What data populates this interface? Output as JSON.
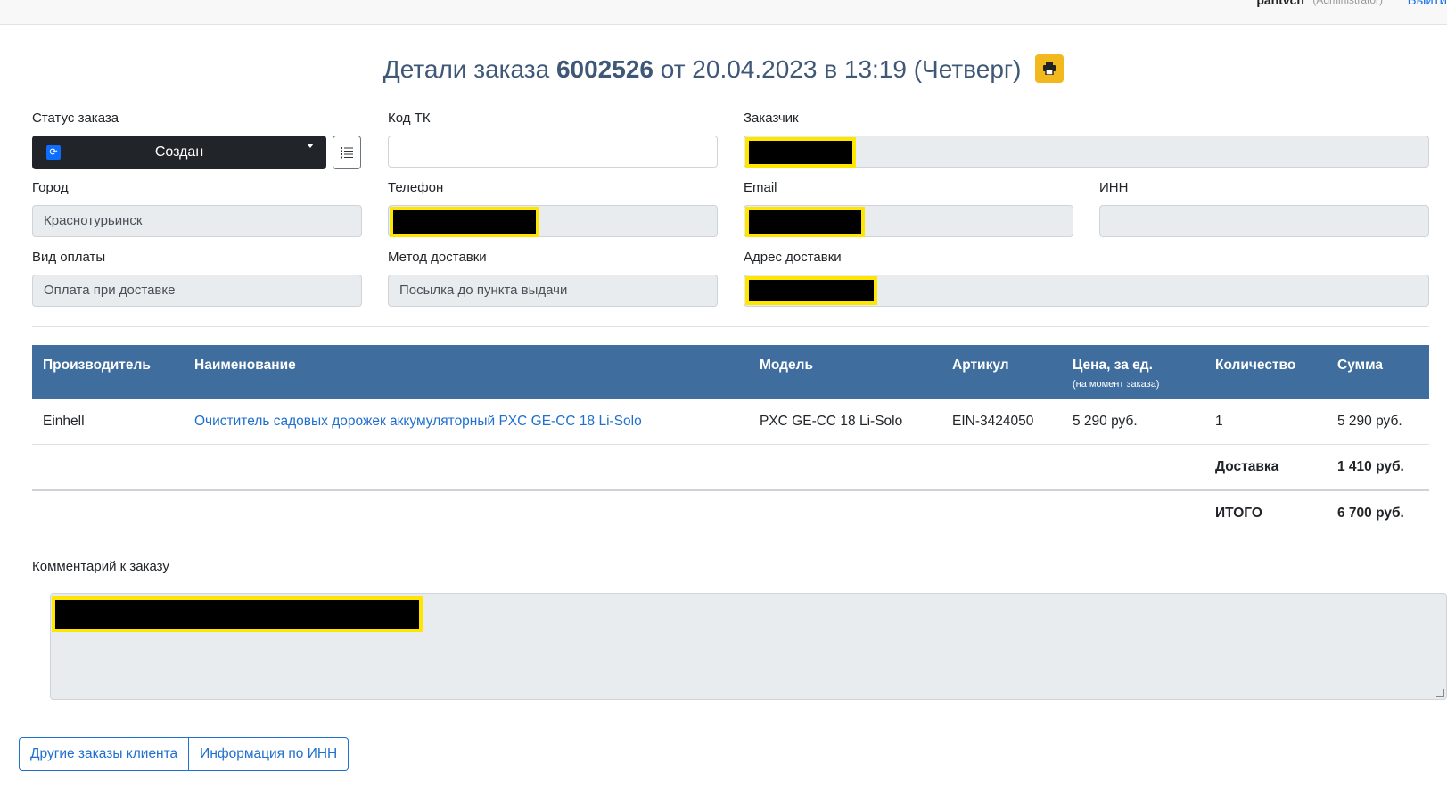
{
  "topbar": {
    "user": "pahtvch",
    "role": "(Administrator)",
    "logout": "Выйти"
  },
  "header": {
    "title_prefix": "Детали заказа",
    "order_number": "6002526",
    "title_suffix": "от 20.04.2023 в 13:19 (Четверг)",
    "print_icon": "print-icon"
  },
  "form": {
    "status": {
      "label": "Статус заказа",
      "value": "Создан"
    },
    "tk_code": {
      "label": "Код ТК",
      "value": ""
    },
    "customer": {
      "label": "Заказчик"
    },
    "city": {
      "label": "Город",
      "value": "Краснотурьинск"
    },
    "phone": {
      "label": "Телефон"
    },
    "email": {
      "label": "Email"
    },
    "inn": {
      "label": "ИНН",
      "value": ""
    },
    "payment": {
      "label": "Вид оплаты",
      "value": "Оплата при доставке"
    },
    "delivery_method": {
      "label": "Метод доставки",
      "value": "Посылка до пункта выдачи"
    },
    "address": {
      "label": "Адрес доставки"
    }
  },
  "table": {
    "headers": {
      "manufacturer": "Производитель",
      "name": "Наименование",
      "model": "Модель",
      "sku": "Артикул",
      "price": "Цена, за ед.",
      "price_note": "(на момент заказа)",
      "qty": "Количество",
      "sum": "Сумма"
    },
    "rows": [
      {
        "manufacturer": "Einhell",
        "name": "Очиститель садовых дорожек аккумуляторный PXC GE-CC 18 Li-Solo",
        "model": "PXC GE-CC 18 Li-Solo",
        "sku": "EIN-3424050",
        "price": "5 290 руб.",
        "qty": "1",
        "sum": "5 290 руб."
      }
    ],
    "delivery": {
      "label": "Доставка",
      "value": "1 410 руб."
    },
    "total": {
      "label": "ИТОГО",
      "value": "6 700 руб."
    }
  },
  "comment": {
    "label": "Комментарий к заказу"
  },
  "buttons": {
    "other_orders": "Другие заказы клиента",
    "inn_info": "Информация по ИНН"
  },
  "colors": {
    "header_bg": "#3f6d9e",
    "title": "#3f5878",
    "print_btn": "#f3b81e",
    "link": "#1f6fcf",
    "total_red": "#e50914"
  }
}
